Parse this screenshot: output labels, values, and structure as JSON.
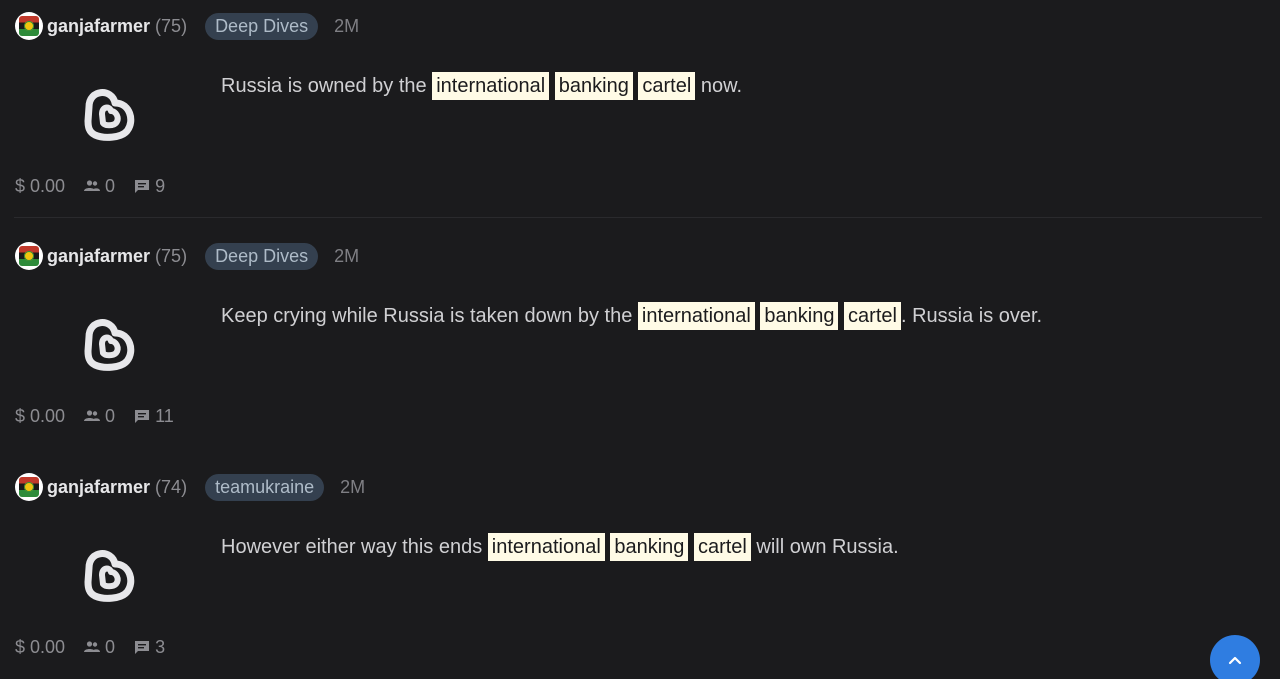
{
  "posts": [
    {
      "author": "ganjafarmer",
      "reputation": "(75)",
      "community": "Deep Dives",
      "age": "2M",
      "body": {
        "before": "Russia is owned by the ",
        "highlights": [
          "international",
          "banking",
          "cartel"
        ],
        "after": " now."
      },
      "payout": "$ 0.00",
      "votes": "0",
      "replies": "9"
    },
    {
      "author": "ganjafarmer",
      "reputation": "(75)",
      "community": "Deep Dives",
      "age": "2M",
      "body": {
        "before": "Keep crying while Russia is taken down by the ",
        "highlights": [
          "international",
          "banking",
          "cartel"
        ],
        "after": ". Russia is over."
      },
      "payout": "$ 0.00",
      "votes": "0",
      "replies": "11"
    },
    {
      "author": "ganjafarmer",
      "reputation": "(74)",
      "community": "teamukraine",
      "age": "2M",
      "body": {
        "before": "However either way this ends ",
        "highlights": [
          "international",
          "banking",
          "cartel"
        ],
        "after": " will own Russia."
      },
      "payout": "$ 0.00",
      "votes": "0",
      "replies": "3"
    }
  ],
  "icons": {
    "avatar": "reggae-flag-avatar-icon",
    "thumbnail": "hive-blog-logo-icon",
    "votes": "people-icon",
    "replies": "comment-icon",
    "scroll_top": "chevron-up-icon"
  },
  "colors": {
    "background": "#1b1b1d",
    "highlight": "#fffbe6",
    "community_badge": "#34404f",
    "scroll_button": "#2f7de1"
  }
}
